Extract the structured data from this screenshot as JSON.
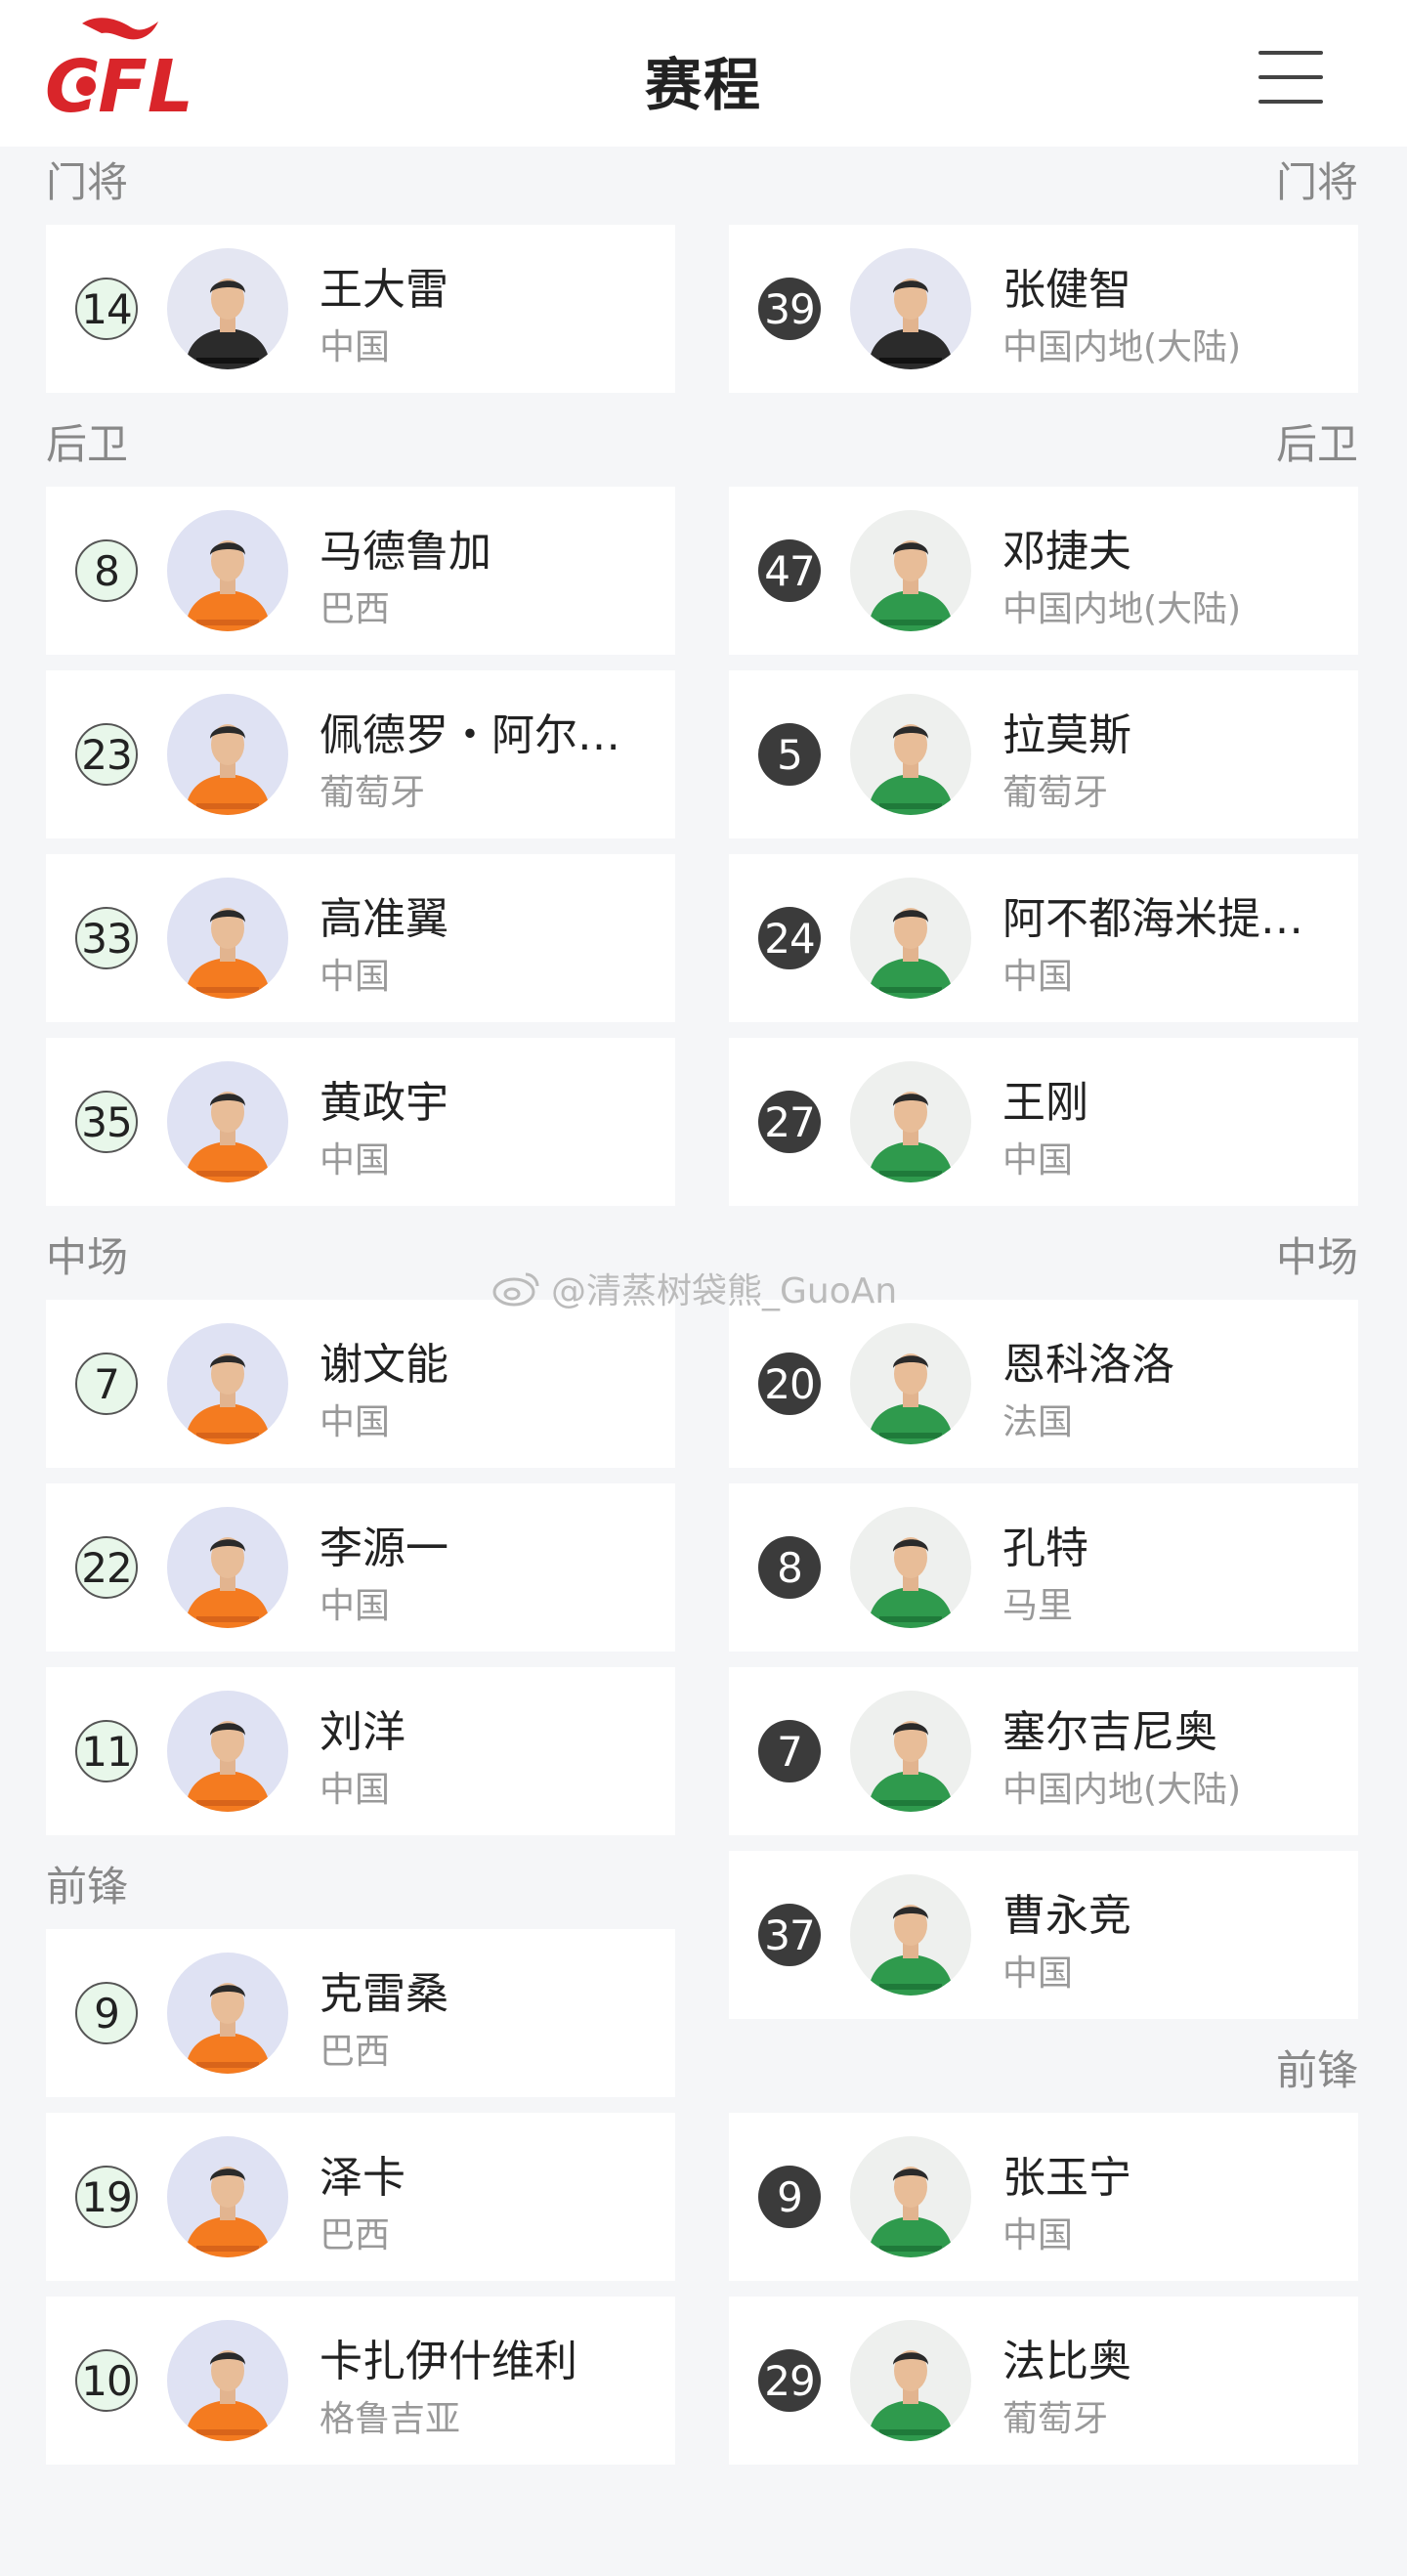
{
  "header": {
    "title": "赛程",
    "logo_text": "CFL"
  },
  "colors": {
    "home_kit": "#f47b20",
    "home_kit_dark": "#d8641a",
    "away_kit": "#2f9a4d",
    "away_kit_dark": "#1f7a3a",
    "gk_kit": "#2b2b2b"
  },
  "watermark": "@清蒸树袋熊_GuoAn",
  "home": {
    "sections": [
      {
        "label": "门将",
        "players": [
          {
            "num": "14",
            "name": "王大雷",
            "nation": "中国",
            "kit": "gk"
          }
        ]
      },
      {
        "label": "后卫",
        "players": [
          {
            "num": "8",
            "name": "马德鲁加",
            "nation": "巴西",
            "kit": "home"
          },
          {
            "num": "23",
            "name": "佩德罗・阿尔…",
            "nation": "葡萄牙",
            "kit": "home"
          },
          {
            "num": "33",
            "name": "高准翼",
            "nation": "中国",
            "kit": "home"
          },
          {
            "num": "35",
            "name": "黄政宇",
            "nation": "中国",
            "kit": "home"
          }
        ]
      },
      {
        "label": "中场",
        "players": [
          {
            "num": "7",
            "name": "谢文能",
            "nation": "中国",
            "kit": "home"
          },
          {
            "num": "22",
            "name": "李源一",
            "nation": "中国",
            "kit": "home"
          },
          {
            "num": "11",
            "name": "刘洋",
            "nation": "中国",
            "kit": "home"
          }
        ]
      },
      {
        "label": "前锋",
        "players": [
          {
            "num": "9",
            "name": "克雷桑",
            "nation": "巴西",
            "kit": "home"
          },
          {
            "num": "19",
            "name": "泽卡",
            "nation": "巴西",
            "kit": "home"
          },
          {
            "num": "10",
            "name": "卡扎伊什维利",
            "nation": "格鲁吉亚",
            "kit": "home"
          }
        ]
      }
    ]
  },
  "away": {
    "sections": [
      {
        "label": "门将",
        "players": [
          {
            "num": "39",
            "name": "张健智",
            "nation": "中国内地(大陆)",
            "kit": "gk"
          }
        ]
      },
      {
        "label": "后卫",
        "players": [
          {
            "num": "47",
            "name": "邓捷夫",
            "nation": "中国内地(大陆)",
            "kit": "away"
          },
          {
            "num": "5",
            "name": "拉莫斯",
            "nation": "葡萄牙",
            "kit": "away"
          },
          {
            "num": "24",
            "name": "阿不都海米提…",
            "nation": "中国",
            "kit": "away"
          },
          {
            "num": "27",
            "name": "王刚",
            "nation": "中国",
            "kit": "away"
          }
        ]
      },
      {
        "label": "中场",
        "players": [
          {
            "num": "20",
            "name": "恩科洛洛",
            "nation": "法国",
            "kit": "away"
          },
          {
            "num": "8",
            "name": "孔特",
            "nation": "马里",
            "kit": "away"
          },
          {
            "num": "7",
            "name": "塞尔吉尼奥",
            "nation": "中国内地(大陆)",
            "kit": "away"
          },
          {
            "num": "37",
            "name": "曹永竞",
            "nation": "中国",
            "kit": "away"
          }
        ]
      },
      {
        "label": "前锋",
        "players": [
          {
            "num": "9",
            "name": "张玉宁",
            "nation": "中国",
            "kit": "away"
          },
          {
            "num": "29",
            "name": "法比奥",
            "nation": "葡萄牙",
            "kit": "away"
          }
        ]
      }
    ]
  }
}
